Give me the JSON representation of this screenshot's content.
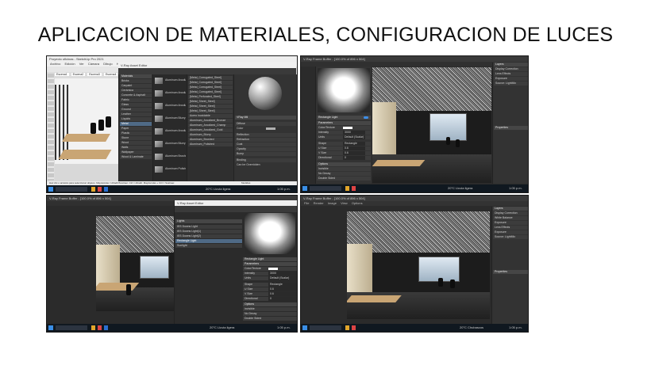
{
  "title": "APLICACION DE MATERIALES, CONFIGURACION DE LUCES",
  "shots": {
    "sketchup": {
      "window_title": "Proyecto oficinas - SketchUp Pro 2021",
      "menu": [
        "Archivo",
        "Edición",
        "Ver",
        "Cámara",
        "Dibujo",
        "Herramientas",
        "Ventana",
        "Extensiones",
        "Ayuda"
      ],
      "scene_tabs": [
        "Escena1",
        "Escena2",
        "Escena3",
        "Escena4",
        "Escena5"
      ],
      "status": "Haz clic o arrastra para seleccionar objetos. Mayúsculas = Añadir/Sustraer. Ctrl = Añadir. Mayúsculas + Ctrl = Sustraer.",
      "measurements_label": "Medidas"
    },
    "asset_editor_1": {
      "window_title": "V-Ray Asset Editor",
      "materials_header": "Materials",
      "categories": [
        "Bricks",
        "Carpaint",
        "Cerámica",
        "Concrete & Asphalt",
        "Fabric",
        "Glass",
        "Ground",
        "Leather",
        "Liquids",
        "Metal",
        "Paper",
        "Plastic",
        "Stone",
        "Wood",
        "Walls",
        "Wallpaper",
        "Wood & Laminate"
      ],
      "material_thumbs": [
        "Aluminum Anodized Bronze",
        "Aluminum Anodized Champagne",
        "Aluminum Anodized Gold",
        "Aluminum Blurry",
        "Aluminum Anodized Gold",
        "Aluminum Blurry",
        "Aluminum Brushed",
        "Aluminum Polished"
      ],
      "material_list": [
        "[Metal_Corrugated_Steel]",
        "[Metal_Corrugated_Steel]",
        "[Metal_Corrugated_Steel]",
        "[Metal_Corrugated_Steel]",
        "[Metal_Perforated_Steel]",
        "[Metal_Sheet_Steel]",
        "[Metal_Sheet_Steel]",
        "[Metal_Sheet_Steel]",
        "Acero inoxidable",
        "Aluminum_Anodized_Bronze",
        "Aluminum_Anodized_Champ",
        "Aluminum_Anodized_Gold",
        "Aluminum_Blurry",
        "Aluminum_Brushed",
        "Aluminum_Polished"
      ],
      "selected_material": "VRay Mtl",
      "props": [
        "Diffuse",
        "Color",
        "Reflection",
        "Refraction",
        "Coat",
        "Opacity",
        "Bump",
        "Binding",
        "Can be Overridden"
      ]
    },
    "frame_buffer_1": {
      "window_title": "V-Ray Frame Buffer - [100.0% of 896 x 504]",
      "light_panel_title": "Rectangle Light",
      "params_header": "Parameters",
      "params": [
        "Color/Texture",
        "Intensity",
        "Units",
        "Shape",
        "U Size",
        "V Size",
        "Directional"
      ],
      "param_values": [
        "",
        "3000",
        "Default (Scalar)",
        "Rectangle",
        "0.6",
        "0.6",
        "0"
      ],
      "options_header": "Options",
      "options": [
        "Invisible",
        "No Decay",
        "Double Sided"
      ],
      "layers_title": "Layers",
      "layers": [
        "Display Correction",
        "Lens Effects",
        "Exposure",
        "Source: LightMix"
      ],
      "properties_title": "Properties"
    },
    "frame_buffer_2": {
      "window_title": "V-Ray Frame Buffer - [100.0% of 896 x 504]",
      "lights_header": "Lights",
      "lights": [
        "IES Downs Light",
        "IES Downs Light(1)",
        "IES Downs Light(2)",
        "Rectangle Light",
        "Sunlight"
      ],
      "light_panel_title": "Rectangle Light",
      "params_header": "Parameters",
      "params": [
        "Color/Texture",
        "Intensity",
        "Units",
        "Shape",
        "U Size",
        "V Size",
        "Directional"
      ],
      "param_values": [
        "",
        "3000",
        "Default (Scalar)",
        "Rectangle",
        "0.6",
        "0.6",
        "0"
      ],
      "options_header": "Options",
      "options": [
        "Invisible",
        "No Decay",
        "Double Sided"
      ]
    },
    "frame_buffer_3": {
      "window_title": "V-Ray Frame Buffer - [100.0% of 896 x 504]",
      "menu": [
        "File",
        "Render",
        "Image",
        "View",
        "Options"
      ],
      "layers_title": "Layers",
      "layers": [
        "Display Correction",
        "White Balance",
        "Exposure",
        "Lens Effects",
        "Exposure",
        "Source: LightMix"
      ],
      "properties_title": "Properties"
    }
  },
  "taskbars": {
    "weather_1": "20°C Lluvia ligera",
    "weather_2": "20°C Lluvia ligera",
    "weather_3": "20°C Lluvia ligera",
    "weather_4": "20°C Chubascos",
    "time": "1:05 p.m.",
    "date": "11/10/2021",
    "lang": "ESP"
  },
  "colors": {
    "accent": "#3d8ee8",
    "panel_bg": "#2b2b2b",
    "taskbar": "#101820"
  }
}
